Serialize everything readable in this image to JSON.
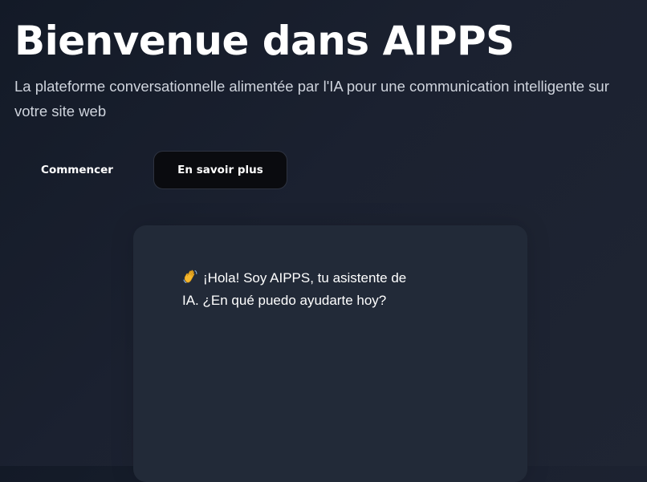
{
  "hero": {
    "title": "Bienvenue dans AIPPS",
    "subtitle": "La plateforme conversationnelle alimentée par l'IA pour une communication intelligente sur votre site web"
  },
  "actions": {
    "primary_label": "Commencer",
    "secondary_label": "En savoir plus"
  },
  "chat": {
    "greeting_icon": "waving-hand-icon",
    "greeting_text": "¡Hola! Soy AIPPS, tu asistente de IA. ¿En qué puedo ayudarte hoy?"
  },
  "colors": {
    "background": "#161c29",
    "card": "#222a38",
    "secondary_button": "#0a0b0f",
    "text": "#ffffff",
    "subtitle_text": "#cfd4dd"
  }
}
